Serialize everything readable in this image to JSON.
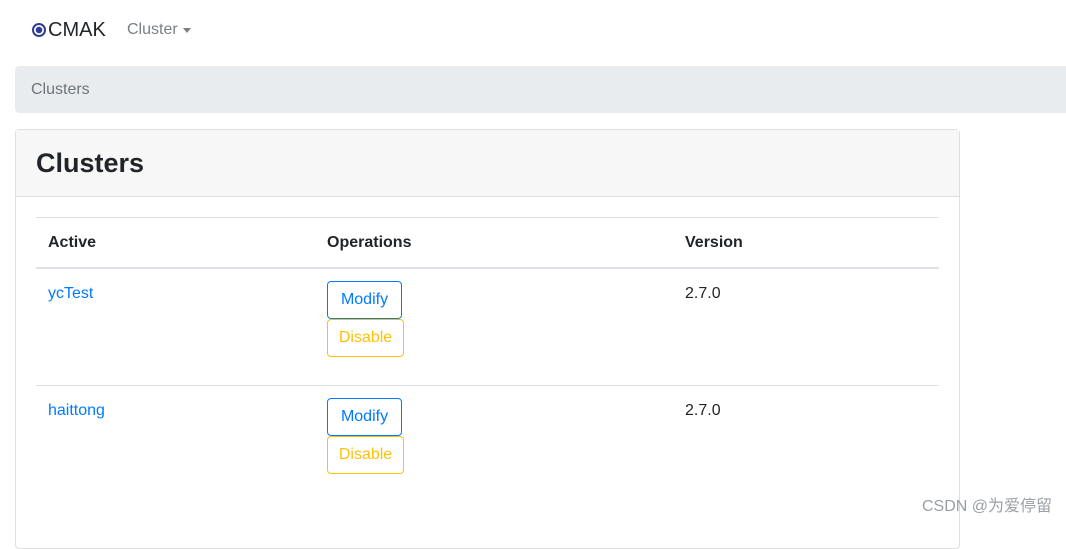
{
  "navbar": {
    "brand": "CMAK",
    "dropdown_label": "Cluster"
  },
  "breadcrumb": {
    "current": "Clusters"
  },
  "card": {
    "title": "Clusters"
  },
  "table": {
    "headers": {
      "active": "Active",
      "operations": "Operations",
      "version": "Version"
    },
    "rows": [
      {
        "name": "ycTest",
        "modify_label": "Modify",
        "disable_label": "Disable",
        "version": "2.7.0"
      },
      {
        "name": "haittong",
        "modify_label": "Modify",
        "disable_label": "Disable",
        "version": "2.7.0"
      }
    ]
  },
  "watermark": "CSDN @为爱停留",
  "colors": {
    "link": "#007bff",
    "warning": "#ffc107",
    "breadcrumb_bg": "#e9ecef",
    "card_header_bg": "#f7f7f7"
  }
}
